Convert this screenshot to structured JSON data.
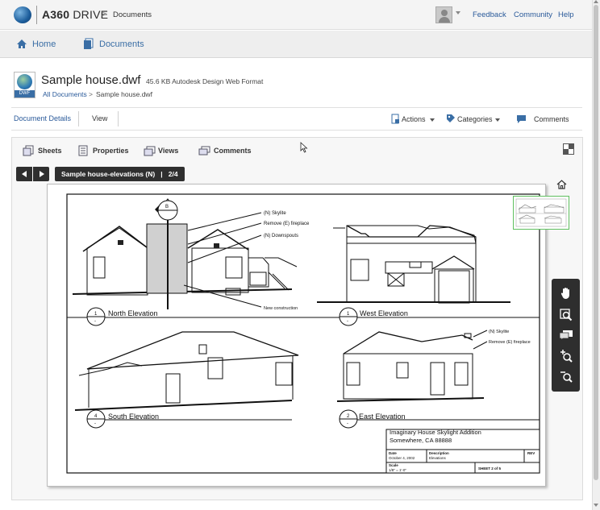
{
  "topbar": {
    "brand_a": "A360",
    "brand_b": " DRIVE",
    "crumb_sep": ">",
    "crumb": "Documents",
    "links": [
      "Feedback",
      "Community",
      "Help"
    ]
  },
  "nav": {
    "home": "Home",
    "documents": "Documents"
  },
  "document": {
    "icon_tag": "DWF",
    "title": "Sample house.dwf",
    "meta": "45.6 KB Autodesk Design Web Format",
    "crumb_all": "All Documents",
    "crumb_sep": ">",
    "crumb_current": "Sample house.dwf"
  },
  "doc_tabs": {
    "details": "Document Details",
    "view": "View"
  },
  "actions": {
    "actions": "Actions",
    "categories": "Categories",
    "comments": "Comments"
  },
  "viewer_tabs": [
    "Sheets",
    "Properties",
    "Views",
    "Comments"
  ],
  "sheet": {
    "label": "Sample house-elevations (N)   |   2/4"
  },
  "drawing": {
    "elevations": [
      {
        "number": "1",
        "sub": "-",
        "title": "North Elevation"
      },
      {
        "number": "1",
        "sub": "-",
        "title": "West Elevation"
      },
      {
        "number": "4",
        "sub": "-",
        "title": "South Elevation"
      },
      {
        "number": "2",
        "sub": "-",
        "title": "East Elevation"
      }
    ],
    "callouts_north": [
      "(N) Skylite",
      "Remove (E) fireplace",
      "(N) Downspouts",
      "New construction"
    ],
    "callouts_east": [
      "(N) Skylite",
      "Remove (E) fireplace"
    ],
    "section_mark": "B",
    "titleblock": {
      "project": "Imaginary House Skylight Addition",
      "location": "Somewhere, CA  88888",
      "date_label": "Date",
      "date": "October 4, 2002",
      "desc_label": "Description",
      "desc": "Elevations",
      "rev_label": "REV",
      "scale_label": "Scale",
      "scale": "1/8\" = 1'-0\"",
      "sheet": "SHEET   2 of 5"
    }
  },
  "tools": [
    "pan-tool",
    "zoom-window-tool",
    "comments-tool",
    "zoom-in-tool",
    "zoom-out-tool"
  ],
  "colors": {
    "link": "#2a5a9a",
    "accent": "#3a6ea5",
    "dark_panel": "#2e2e2e",
    "thumb_border": "#5fbf5f"
  }
}
